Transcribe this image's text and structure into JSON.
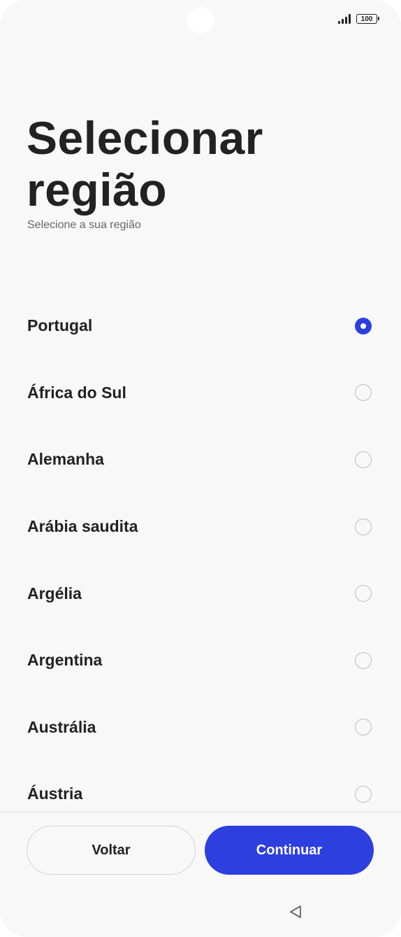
{
  "status_bar": {
    "battery_level": "100",
    "signal_icon": "signal-icon",
    "battery_icon": "battery-icon"
  },
  "header": {
    "title": "Selecionar região",
    "subtitle": "Selecione a sua região"
  },
  "regions": [
    {
      "label": "Portugal",
      "selected": true
    },
    {
      "label": "África do Sul",
      "selected": false
    },
    {
      "label": "Alemanha",
      "selected": false
    },
    {
      "label": "Arábia saudita",
      "selected": false
    },
    {
      "label": "Argélia",
      "selected": false
    },
    {
      "label": "Argentina",
      "selected": false
    },
    {
      "label": "Austrália",
      "selected": false
    },
    {
      "label": "Áustria",
      "selected": false
    }
  ],
  "footer": {
    "back_label": "Voltar",
    "continue_label": "Continuar"
  },
  "colors": {
    "accent": "#2e3fe0",
    "text": "#222222",
    "subtitle": "#666666",
    "background": "#f8f8f8"
  },
  "nav": {
    "back_icon": "triangle-back-icon"
  }
}
